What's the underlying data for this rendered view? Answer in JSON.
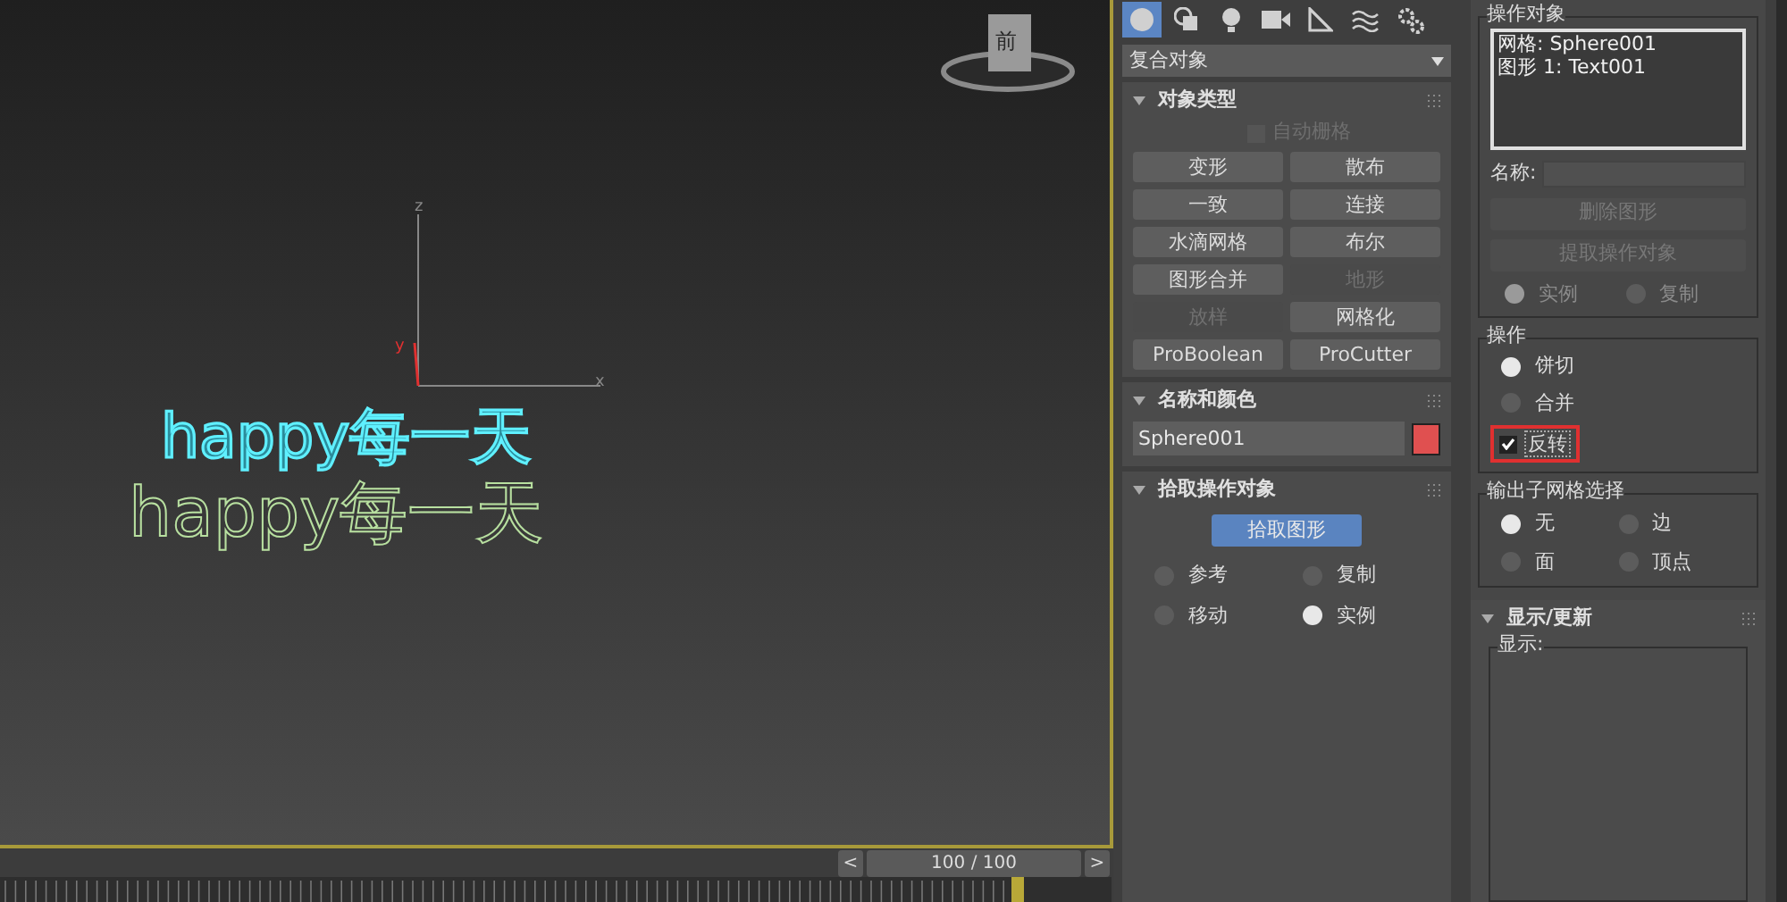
{
  "viewport": {
    "viewcube_label": "前",
    "axes": {
      "z": "z",
      "x": "x",
      "y": "y"
    },
    "scene_texts": [
      {
        "text": "happy每一天",
        "selected": true
      },
      {
        "text": "happy每一天",
        "selected": false
      }
    ],
    "time_slider": {
      "prev": "<",
      "value": "100 / 100",
      "next": ">"
    }
  },
  "command_panel": {
    "tabs": [
      {
        "kind": "geometry",
        "selected": true
      },
      {
        "kind": "shapes",
        "selected": false
      },
      {
        "kind": "lights",
        "selected": false
      },
      {
        "kind": "cameras",
        "selected": false
      },
      {
        "kind": "helpers",
        "selected": false
      },
      {
        "kind": "spacewarps",
        "selected": false
      },
      {
        "kind": "systems",
        "selected": false
      }
    ],
    "category": "复合对象",
    "object_type": {
      "title": "对象类型",
      "autogrid": {
        "label": "自动栅格",
        "checked": false,
        "disabled": true
      },
      "buttons": [
        {
          "label": "变形",
          "disabled": false
        },
        {
          "label": "散布",
          "disabled": false
        },
        {
          "label": "一致",
          "disabled": false
        },
        {
          "label": "连接",
          "disabled": false
        },
        {
          "label": "水滴网格",
          "disabled": false
        },
        {
          "label": "布尔",
          "disabled": false
        },
        {
          "label": "图形合并",
          "disabled": false
        },
        {
          "label": "地形",
          "disabled": true
        },
        {
          "label": "放样",
          "disabled": true
        },
        {
          "label": "网格化",
          "disabled": false
        },
        {
          "label": "ProBoolean",
          "disabled": false
        },
        {
          "label": "ProCutter",
          "disabled": false
        }
      ]
    },
    "name_color": {
      "title": "名称和颜色",
      "name": "Sphere001",
      "color": "#e05050"
    },
    "pick_operand": {
      "title": "拾取操作对象",
      "button": "拾取图形",
      "options": [
        {
          "label": "参考",
          "selected": false
        },
        {
          "label": "复制",
          "selected": false
        },
        {
          "label": "移动",
          "selected": false
        },
        {
          "label": "实例",
          "selected": true
        }
      ]
    }
  },
  "parameters": {
    "operands": {
      "title": "操作对象",
      "items": [
        "网格: Sphere001",
        "图形 1: Text001"
      ],
      "name_label": "名称:",
      "delete_button": "删除图形",
      "extract_button": "提取操作对象",
      "options": [
        {
          "label": "实例",
          "selected": true
        },
        {
          "label": "复制",
          "selected": false
        }
      ]
    },
    "operation": {
      "title": "操作",
      "options": [
        {
          "label": "饼切",
          "selected": true
        },
        {
          "label": "合并",
          "selected": false
        }
      ],
      "invert": {
        "label": "反转",
        "checked": true,
        "highlighted": true
      }
    },
    "output_selection": {
      "title": "输出子网格选择",
      "options": [
        {
          "label": "无",
          "selected": true
        },
        {
          "label": "边",
          "selected": false
        },
        {
          "label": "面",
          "selected": false
        },
        {
          "label": "顶点",
          "selected": false
        }
      ]
    },
    "display_update": {
      "title": "显示/更新",
      "display_label": "显示:"
    }
  }
}
